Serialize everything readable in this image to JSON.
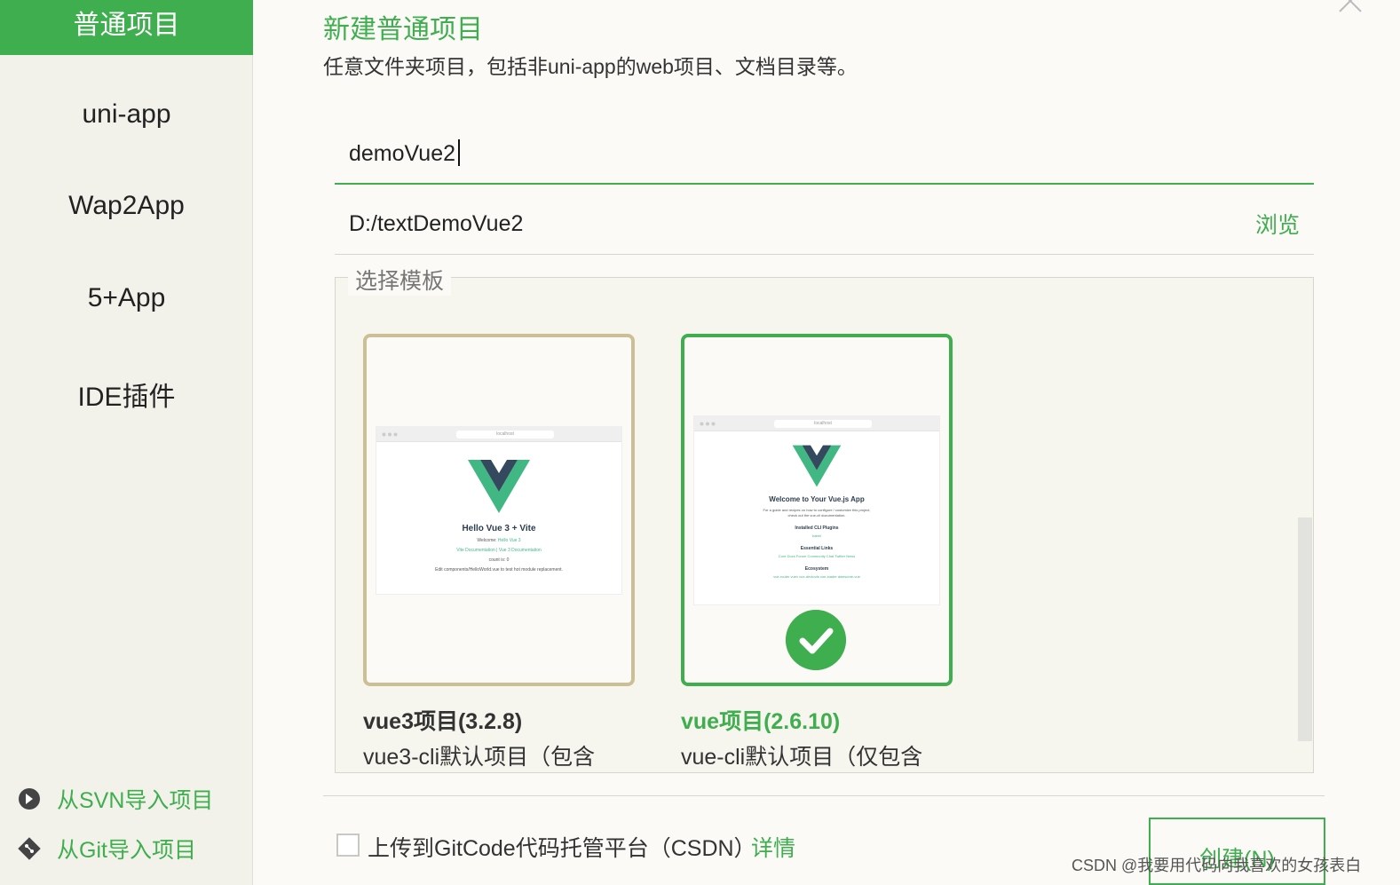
{
  "sidebar": {
    "items": [
      {
        "label": "普通项目",
        "active": true
      },
      {
        "label": "uni-app"
      },
      {
        "label": "Wap2App"
      },
      {
        "label": "5+App"
      },
      {
        "label": "IDE插件"
      }
    ],
    "import_svn": "从SVN导入项目",
    "import_git": "从Git导入项目"
  },
  "header": {
    "title": "新建普通项目",
    "subtitle": "任意文件夹项目，包括非uni-app的web项目、文档目录等。"
  },
  "form": {
    "project_name": "demoVue2",
    "location": "D:/textDemoVue2",
    "browse_label": "浏览"
  },
  "templates": {
    "legend": "选择模板",
    "cards": [
      {
        "title": "vue3项目(3.2.8)",
        "desc": "vue3-cli默认项目（包含",
        "selected": false,
        "preview": {
          "url": "localhost",
          "heading": "Hello Vue 3 + Vite",
          "line1_prefix": "Welcome: ",
          "line1_link": "Hello Vue 3",
          "line2": "Vite Documentation | Vue 3 Documentation",
          "line3": "count is: 0",
          "line4": "Edit components/HelloWorld.vue to test hot module replacement."
        }
      },
      {
        "title": "vue项目(2.6.10)",
        "desc": "vue-cli默认项目（仅包含",
        "selected": true,
        "preview": {
          "url": "localhost",
          "heading": "Welcome to Your Vue.js App",
          "line1": "For a guide and recipes on how to configure / customize this project,",
          "line2": "check out the vue-cli documentation.",
          "section1": "Installed CLI Plugins",
          "section1_links": "babel",
          "section2": "Essential Links",
          "section2_links": "Core Docs   Forum   Community Chat   Twitter   News",
          "section3": "Ecosystem",
          "section3_links": "vue-router   vuex   vue-devtools   vue-loader   awesome-vue"
        }
      }
    ]
  },
  "footer": {
    "upload_label": "上传到GitCode代码托管平台（CSDN）",
    "details_label": "详情",
    "create_label": "创建(N)",
    "watermark": "CSDN @我要用代码向我喜欢的女孩表白"
  },
  "colors": {
    "accent": "#3fae4f",
    "sidebar_bg": "#f3f2ea",
    "page_bg": "#fbfaf6",
    "card_unselected_border": "#cdbf95"
  }
}
